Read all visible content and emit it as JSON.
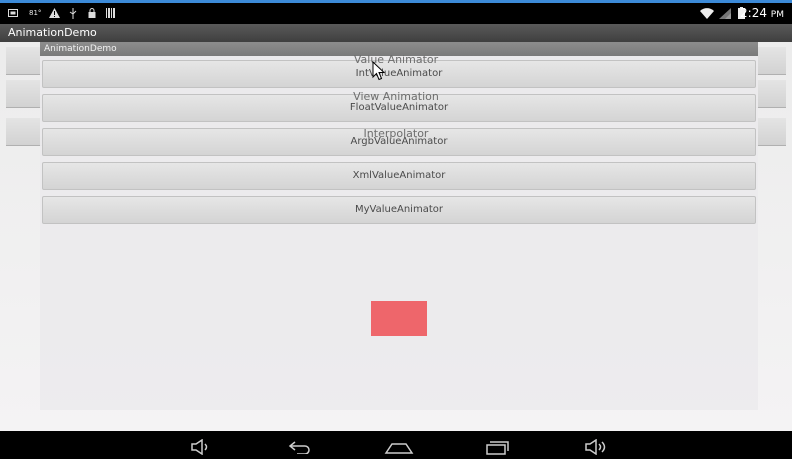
{
  "status_bar": {
    "time": "2:24",
    "time_suffix": "PM",
    "left_icons": [
      "screenshot-icon",
      "notification-81-icon",
      "warning-icon",
      "usb-icon",
      "lock-icon",
      "barcode-icon"
    ],
    "right_icons": [
      "wifi-icon",
      "signal-icon",
      "battery-icon"
    ]
  },
  "action_bar": {
    "title": "AnimationDemo"
  },
  "underlying_menu": {
    "items": [
      {
        "label": "Value Animator"
      },
      {
        "label": "View Animation"
      },
      {
        "label": "Interpolator"
      }
    ]
  },
  "dialog": {
    "title": "AnimationDemo",
    "buttons": [
      {
        "label": "IntValueAnimator"
      },
      {
        "label": "FloatValueAnimator"
      },
      {
        "label": "ArgbValueAnimator"
      },
      {
        "label": "XmlValueAnimator"
      },
      {
        "label": "MyValueAnimator"
      }
    ],
    "animated_view_color": "#ee666b"
  },
  "nav_bar": {
    "buttons": [
      "volume-down-icon",
      "back-icon",
      "home-icon",
      "recent-apps-icon",
      "volume-up-icon"
    ]
  },
  "colors": {
    "status_accent": "#3c8ad8"
  }
}
